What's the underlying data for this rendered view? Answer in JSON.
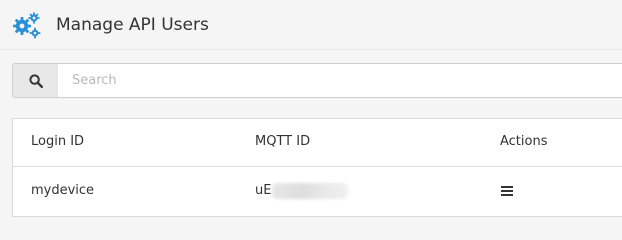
{
  "header": {
    "icon": "gears-icon",
    "title": "Manage API Users",
    "accent_color": "#2a8fd6"
  },
  "search": {
    "icon": "search-icon",
    "placeholder": "Search",
    "value": ""
  },
  "table": {
    "columns": [
      "Login ID",
      "MQTT ID",
      "Actions"
    ],
    "rows": [
      {
        "login_id": "mydevice",
        "mqtt_id_prefix": "uE",
        "mqtt_id_redacted": true,
        "actions_icon": "hamburger-menu-icon"
      }
    ]
  }
}
